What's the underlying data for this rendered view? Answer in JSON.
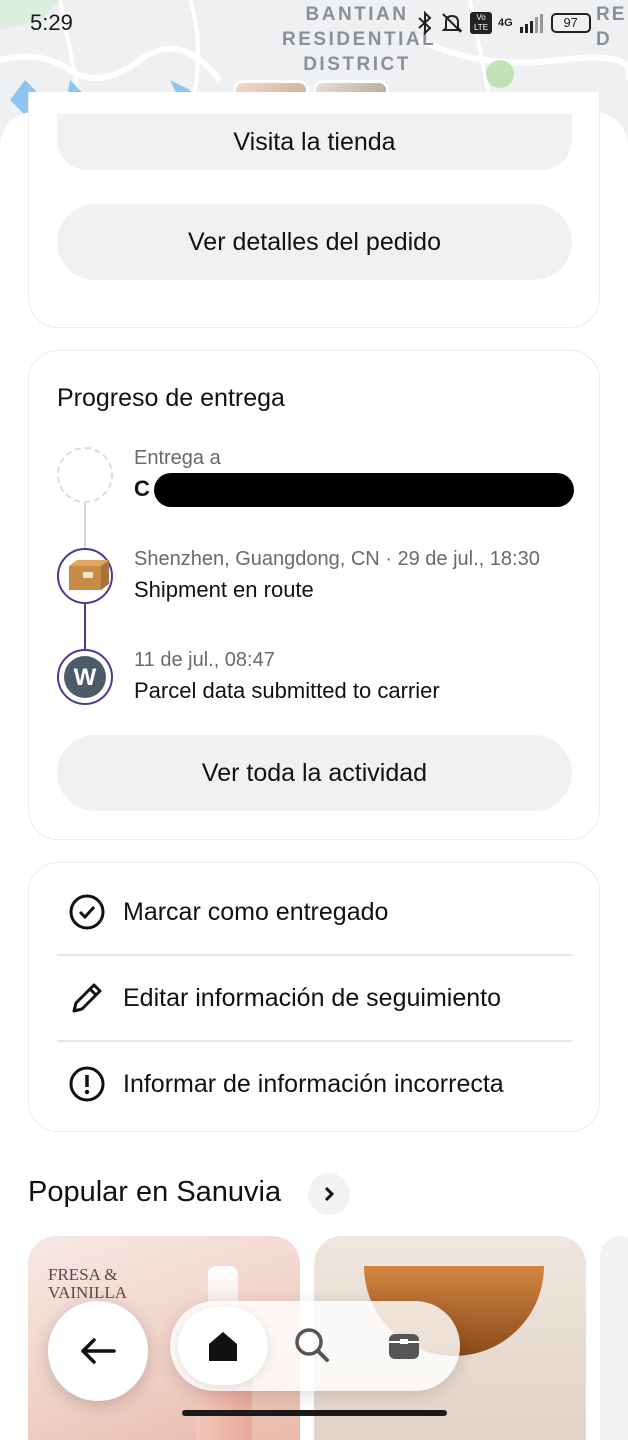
{
  "status_bar": {
    "time": "5:29",
    "battery": "97",
    "network": "4G",
    "volte": "Vo LTE"
  },
  "map": {
    "district_label_1": "BANTIAN",
    "district_label_2": "RESIDENTIAL",
    "district_label_3": "DISTRICT",
    "edge_label": "RE D"
  },
  "order_actions": {
    "visit_store": "Visita la tienda",
    "order_details": "Ver detalles del pedido"
  },
  "delivery_progress": {
    "title": "Progreso de entrega",
    "steps": [
      {
        "sub": "Entrega a",
        "main": "C"
      },
      {
        "sub": "Shenzhen, Guangdong, CN · 29 de jul., 18:30",
        "main": "Shipment en route"
      },
      {
        "sub": "11 de jul., 08:47",
        "main": "Parcel data submitted to carrier"
      }
    ],
    "view_all": "Ver toda la actividad"
  },
  "actions": [
    {
      "label": "Marcar como entregado",
      "icon": "check-circle-icon"
    },
    {
      "label": "Editar información de seguimiento",
      "icon": "pencil-icon"
    },
    {
      "label": "Informar de información incorrecta",
      "icon": "exclamation-circle-icon"
    }
  ],
  "popular": {
    "title": "Popular en Sanuvia",
    "products": [
      {
        "brand_line_1": "FRESA &",
        "brand_line_2": "VAINILLA"
      },
      {
        "name": ""
      }
    ]
  },
  "bottom_nav": {
    "back": "back-arrow-icon",
    "items": [
      "home-icon",
      "search-icon",
      "orders-icon"
    ]
  }
}
